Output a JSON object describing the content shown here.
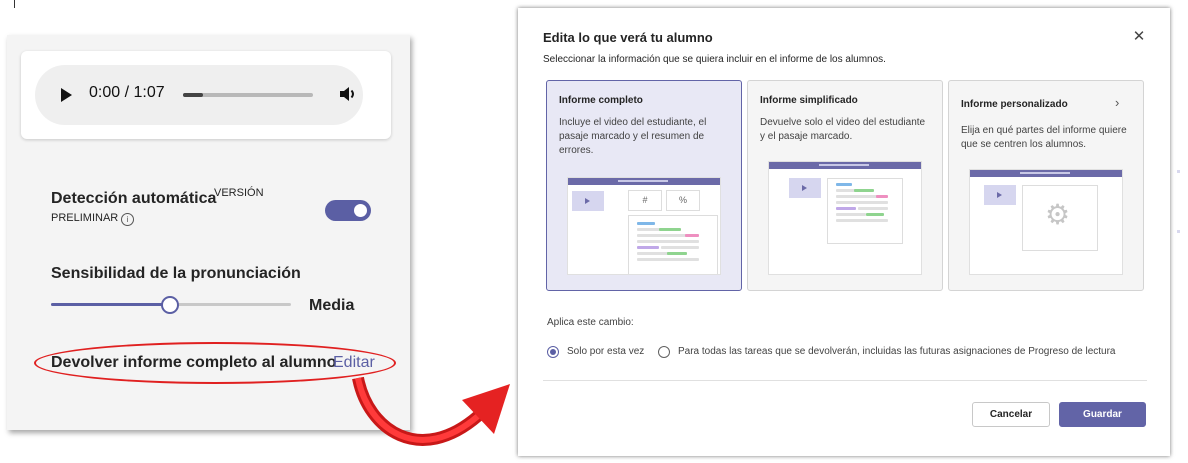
{
  "player": {
    "time": "0:00 / 1:07",
    "progress": 0.15
  },
  "settings": {
    "auto_label": "Detección automática",
    "auto_sup": "VERSIÓN",
    "auto_sub": "PRELIMINAR",
    "info_glyph": "i",
    "auto_enabled": true,
    "sens_label": "Sensibilidad de la pronunciación",
    "sens_level": 0.5,
    "sens_value": "Media",
    "return_label": "Devolver informe completo al alumno",
    "edit_link": "Editar"
  },
  "dialog": {
    "title": "Edita lo que verá tu alumno",
    "subtitle": "Seleccionar la información que se quiera incluir en el informe de los alumnos.",
    "close_glyph": "✕",
    "cards": [
      {
        "title": "Informe completo",
        "desc": "Incluye el video del estudiante, el pasaje marcado y el resumen de errores.",
        "selected": true,
        "box1": "#",
        "box2": "%"
      },
      {
        "title": "Informe simplificado",
        "desc": "Devuelve solo el video del estudiante y el pasaje marcado.",
        "selected": false
      },
      {
        "title": "Informe personalizado",
        "desc": "Elija en qué partes del informe quiere que se centren los alumnos.",
        "selected": false,
        "chevron": "›",
        "gear": "⚙"
      }
    ],
    "apply_label": "Aplica este cambio:",
    "options": [
      {
        "label": "Solo por esta vez",
        "checked": true
      },
      {
        "label": "Para todas las tareas que se devolverán, incluidas las futuras asignaciones de Progreso de lectura",
        "checked": false
      }
    ],
    "cancel": "Cancelar",
    "save": "Guardar"
  },
  "colors": {
    "accent": "#6264a7",
    "annotation": "#e02020",
    "panel": "#f4f4f4"
  }
}
